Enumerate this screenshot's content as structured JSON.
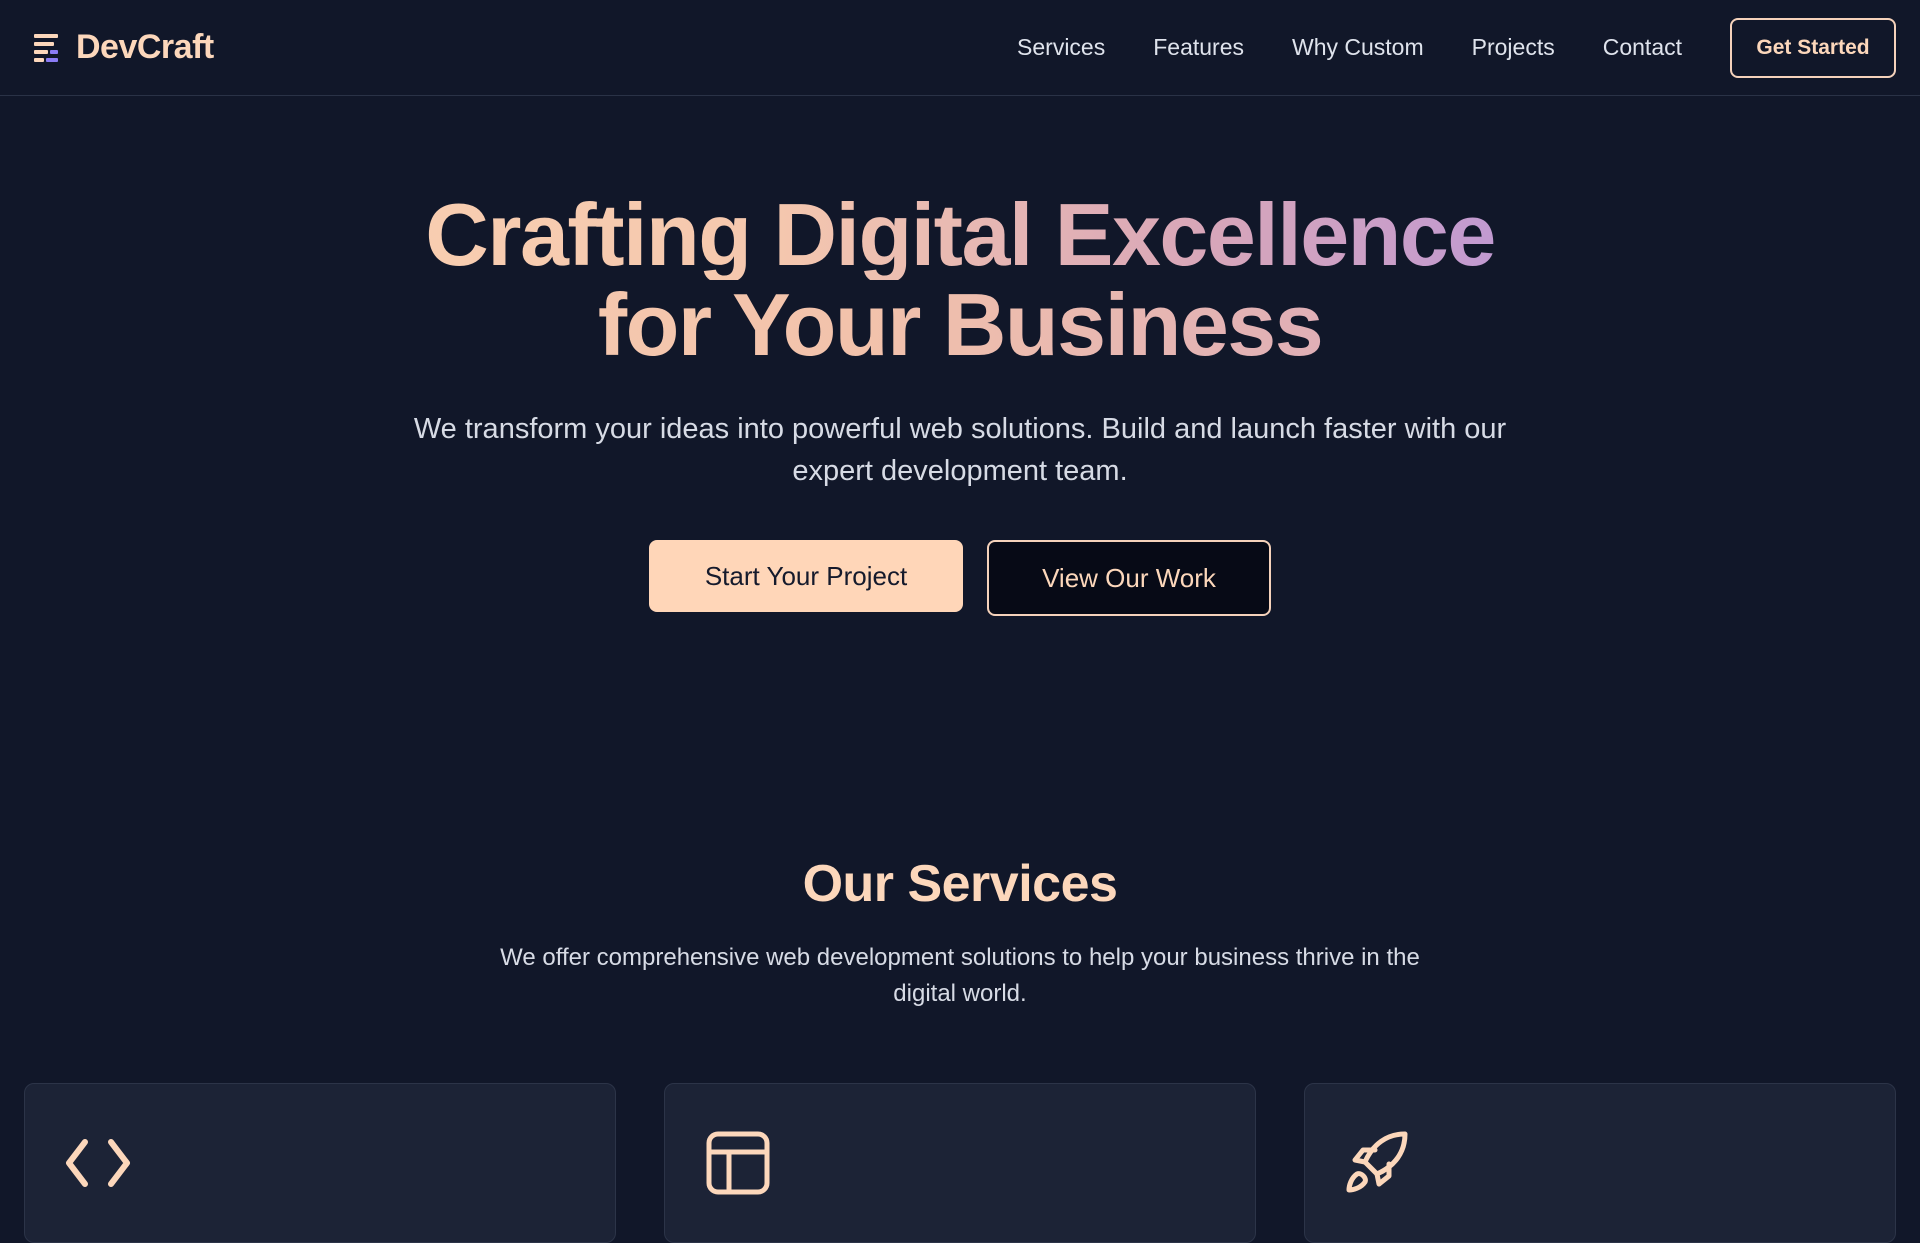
{
  "brand": {
    "name": "DevCraft",
    "icon": "menu-lines-icon",
    "accent": "#8b7cf6"
  },
  "nav": {
    "links": [
      "Services",
      "Features",
      "Why Custom",
      "Projects",
      "Contact"
    ],
    "cta": "Get Started"
  },
  "hero": {
    "title_line1": "Crafting Digital Excellence",
    "title_line2": "for Your Business",
    "subtitle": "We transform your ideas into powerful web solutions. Build and launch faster with our expert development team.",
    "primary_button": "Start Your Project",
    "secondary_button": "View Our Work"
  },
  "services": {
    "title": "Our Services",
    "subtitle": "We offer comprehensive web development solutions to help your business thrive in the digital world.",
    "cards": [
      {
        "icon": "code-icon"
      },
      {
        "icon": "layout-icon"
      },
      {
        "icon": "rocket-icon"
      }
    ]
  },
  "colors": {
    "background": "#111729",
    "peach": "#fcd7bb",
    "button_fill": "#ffd6b8",
    "card_bg": "#1c2336",
    "gradient_end": "#8f7ff0"
  }
}
